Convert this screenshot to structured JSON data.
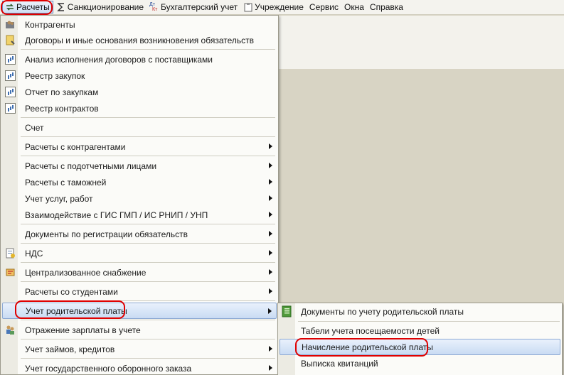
{
  "menubar": {
    "items": [
      {
        "label": "Расчеты",
        "icon": "arrows-icon"
      },
      {
        "label": "Санкционирование",
        "icon": "sigma-icon"
      },
      {
        "label": "Бухгалтерский учет",
        "icon": "dt-kt-icon",
        "icon_text_top": "Дт",
        "icon_text_bottom": "Кт"
      },
      {
        "label": "Учреждение",
        "icon": "clipboard-icon"
      },
      {
        "label": "Сервис"
      },
      {
        "label": "Окна"
      },
      {
        "label": "Справка"
      }
    ]
  },
  "menu": {
    "items": [
      {
        "label": "Контрагенты",
        "icon": "folder-people-icon"
      },
      {
        "label": "Договоры и иные основания возникновения обязательств",
        "icon": "contract-icon"
      },
      {
        "label": "Анализ исполнения договоров с поставщиками",
        "icon": "report-icon"
      },
      {
        "label": "Реестр закупок",
        "icon": "report-icon"
      },
      {
        "label": "Отчет по закупкам",
        "icon": "report-icon"
      },
      {
        "label": "Реестр контрактов",
        "icon": "report-icon"
      },
      {
        "label": "Счет"
      },
      {
        "label": "Расчеты с контрагентами",
        "has_submenu": true
      },
      {
        "label": "Расчеты с подотчетными лицами",
        "has_submenu": true
      },
      {
        "label": "Расчеты с таможней",
        "has_submenu": true
      },
      {
        "label": "Учет услуг, работ",
        "has_submenu": true
      },
      {
        "label": "Взаимодействие с ГИС ГМП / ИС РНИП / УНП",
        "has_submenu": true
      },
      {
        "label": "Документы по регистрации обязательств",
        "has_submenu": true
      },
      {
        "label": "НДС",
        "icon": "vat-icon",
        "has_submenu": true
      },
      {
        "label": "Централизованное снабжение",
        "icon": "supply-icon",
        "has_submenu": true
      },
      {
        "label": "Расчеты со студентами",
        "has_submenu": true
      },
      {
        "label": "Учет родительской платы",
        "has_submenu": true,
        "highlighted": true
      },
      {
        "label": "Отражение зарплаты в учете",
        "icon": "people-icon"
      },
      {
        "label": "Учет займов, кредитов",
        "has_submenu": true
      },
      {
        "label": "Учет государственного оборонного заказа",
        "has_submenu": true
      }
    ]
  },
  "submenu": {
    "items": [
      {
        "label": "Документы по учету родительской платы",
        "icon": "journal-icon"
      },
      {
        "label": "Табели учета посещаемости детей"
      },
      {
        "label": "Начисление родительской платы",
        "highlighted": true
      },
      {
        "label": "Выписка квитанций"
      }
    ]
  },
  "colors": {
    "annotation": "#e00000",
    "highlight": "#c9dbf3",
    "workspace": "#d8d4c4"
  }
}
